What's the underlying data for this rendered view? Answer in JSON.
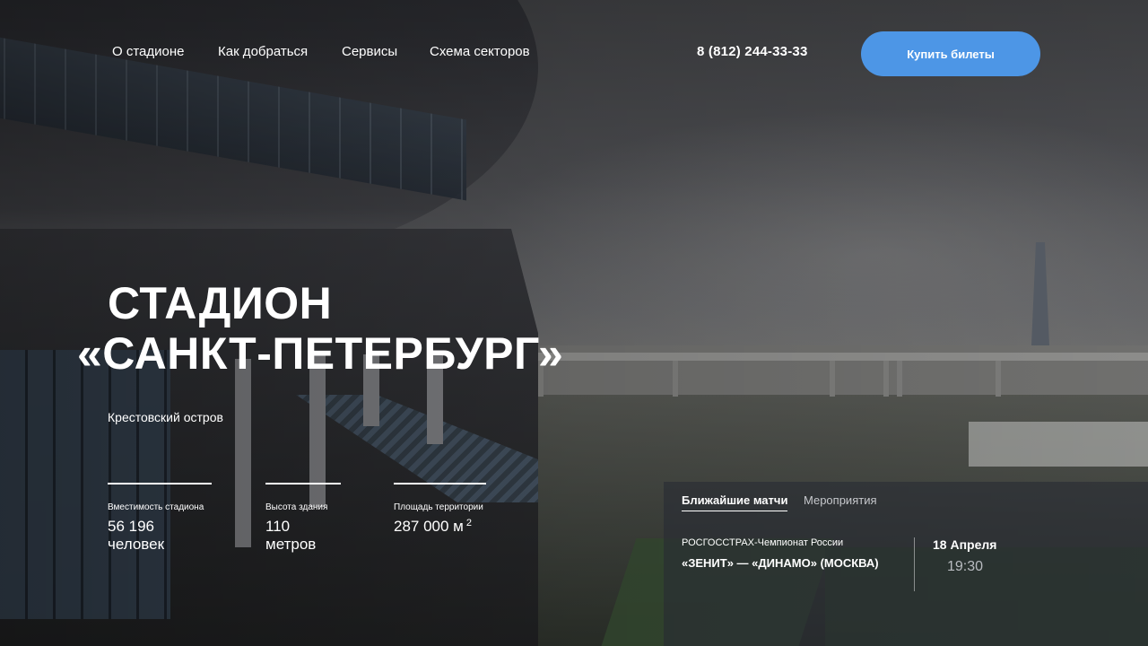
{
  "nav": {
    "items": [
      {
        "label": "О стадионе"
      },
      {
        "label": "Как добраться"
      },
      {
        "label": "Сервисы"
      },
      {
        "label": "Схема секторов"
      }
    ],
    "phone": "8 (812) 244-33-33",
    "buy_label": "Купить билеты",
    "buy_color": "#4d96e6"
  },
  "hero": {
    "title_line1": "СТАДИОН",
    "title_line2": "«САНКТ-ПЕТЕРБУРГ»",
    "subtitle": "Крестовский остров"
  },
  "stats": [
    {
      "label": "Вместимость стадиона",
      "value": "56 196 человек"
    },
    {
      "label": "Высота здания",
      "value": "110 метров"
    },
    {
      "label": "Площадь территории",
      "value": "287 000 м",
      "sup": "2"
    }
  ],
  "matches": {
    "tabs": [
      {
        "label": "Ближайшие матчи",
        "active": true
      },
      {
        "label": "Мероприятия",
        "active": false
      }
    ],
    "event": {
      "league": "РОСГОССТРАХ-Чемпионат России",
      "teams": "«ЗЕНИТ» — «ДИНАМО» (МОСКВА)",
      "date": "18 Апреля",
      "time": "19:30"
    }
  }
}
